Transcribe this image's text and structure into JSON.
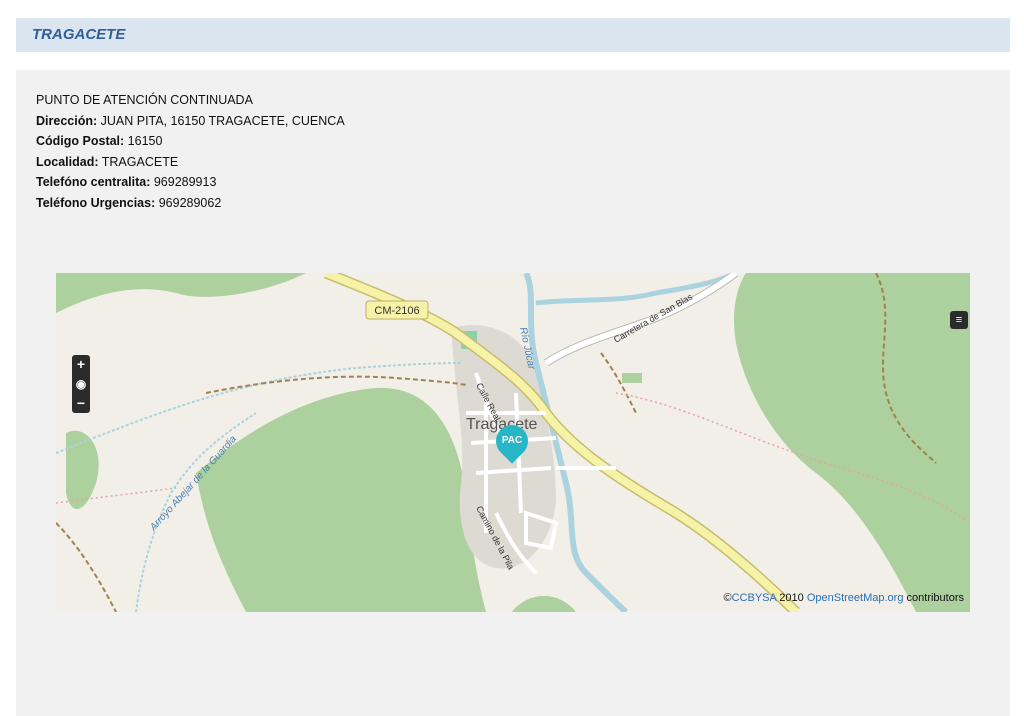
{
  "header": {
    "title": "TRAGACETE"
  },
  "info": {
    "center_name": "PUNTO DE ATENCIÓN CONTINUADA",
    "address_label": "Dirección:",
    "address_value": " JUAN PITA, 16150 TRAGACETE, CUENCA",
    "postal_label": "Código Postal:",
    "postal_value": " 16150",
    "locality_label": "Localidad:",
    "locality_value": " TRAGACETE",
    "phone_label": "Telefóno centralita:",
    "phone_value": " 969289913",
    "urgent_label": "Teléfono Urgencias:",
    "urgent_value": " 969289062"
  },
  "map": {
    "road_label": "CM-2106",
    "town_label": "Tragacete",
    "street_calle_real": "Calle Real",
    "street_san_blas": "Carretera de San Blas",
    "street_pila": "Camino de la Pila",
    "river_jucar": "Río Júcar",
    "stream_guardia": "Arroyo Abejar de la Guardia",
    "marker_label": "PAC",
    "zoom_in": "+",
    "zoom_reset": "◉",
    "zoom_out": "−",
    "layers_icon": "layers-icon",
    "attribution_prefix": "©",
    "attribution_license": "CCBYSA",
    "attribution_year": " 2010 ",
    "attribution_osm": "OpenStreetMap.org",
    "attribution_suffix": " contributors"
  },
  "colors": {
    "forest": "#add19e",
    "road_yellow": "#f6f2a8",
    "road_border": "#c6be6c",
    "water": "#aad3df",
    "built": "#ddd9d3",
    "marker": "#27b6c6"
  }
}
